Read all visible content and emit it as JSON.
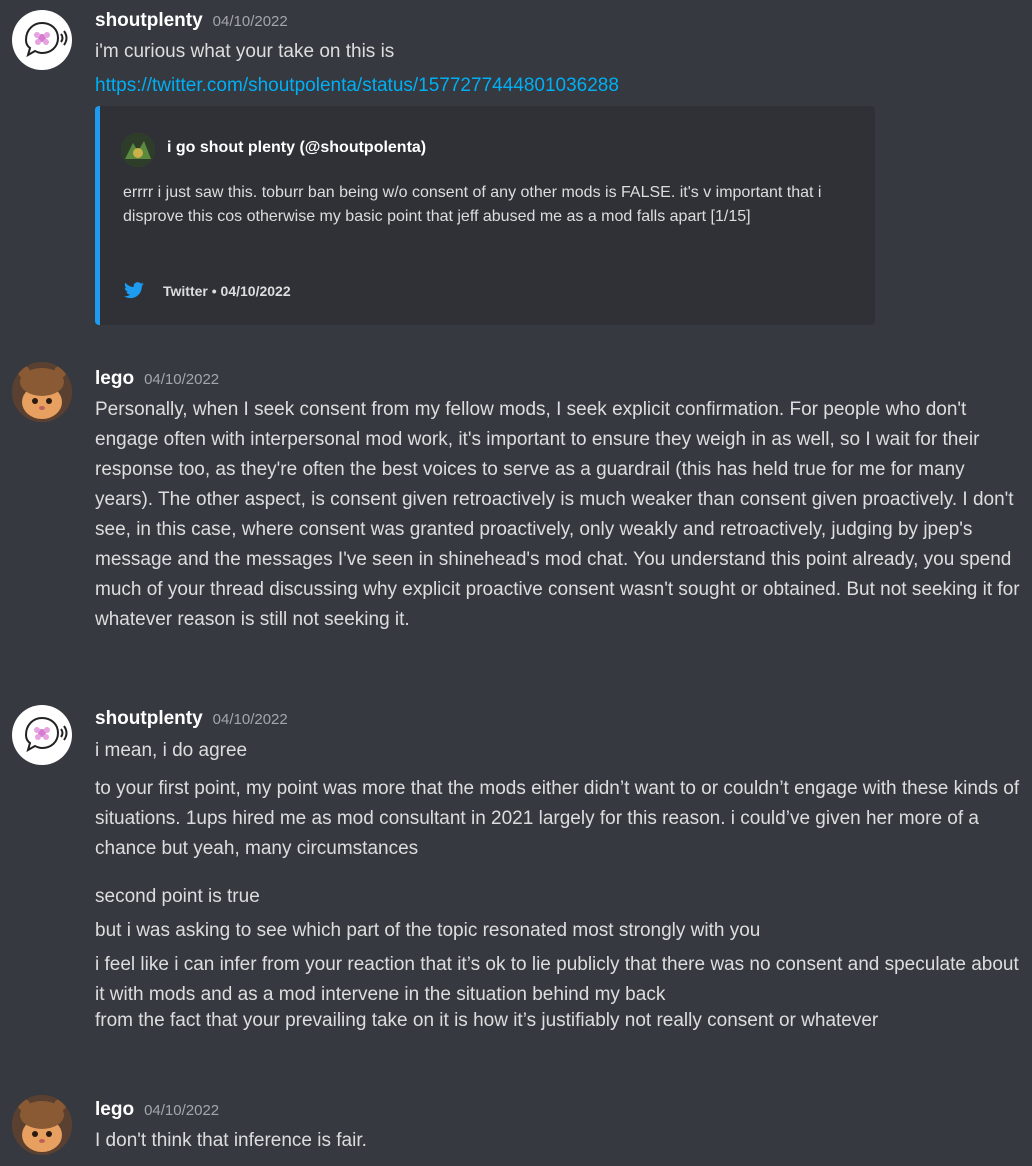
{
  "messages": [
    {
      "author": "shoutplenty",
      "timestamp": "04/10/2022",
      "lines": [
        "i'm curious what your take on this is"
      ],
      "link": "https://twitter.com/shoutpolenta/status/1577277444801036288",
      "embed": {
        "author": "i go shout plenty (@shoutpolenta)",
        "description": "errrr i just saw this. toburr ban being w/o consent of any other mods is FALSE. it's v important that i disprove this cos otherwise my basic point that jeff abused me as a mod falls apart [1/15]",
        "footer": "Twitter • 04/10/2022",
        "accent_color": "#1d9bf0"
      }
    },
    {
      "author": "lego",
      "timestamp": "04/10/2022",
      "text": "Personally, when I seek consent from my fellow mods, I seek explicit confirmation. For people who don't engage often with interpersonal mod work, it's important to ensure they weigh in as well, so I wait for their response too, as they're often the best voices to serve as a guardrail (this has held true for me for many years). The other aspect, is consent given retroactively is much weaker than consent given proactively. I don't see, in this case, where consent was granted proactively, only weakly and retroactively, judging by jpep's message and the messages I've seen in shinehead's mod chat. You understand this point already, you spend much of your thread discussing why explicit proactive consent wasn't sought or obtained. But not seeking it for whatever reason is still not seeking it."
    },
    {
      "author": "shoutplenty",
      "timestamp": "04/10/2022",
      "lines": [
        "i mean, i do agree",
        "to your first point, my point was more that the mods either didn’t want to or couldn’t engage with these kinds of situations. 1ups hired me as mod consultant in 2021 largely for this reason. i could’ve given her more of a chance but yeah, many circumstances",
        "second point is true",
        "but i was asking to see which part of the topic resonated most strongly with you",
        "i feel like i can infer from your reaction that it’s ok to lie publicly that there was no consent and speculate about it with mods and as a mod intervene in the situation behind my back",
        "from the fact that your prevailing take on it is how it’s justifiably not really consent or whatever"
      ]
    },
    {
      "author": "lego",
      "timestamp": "04/10/2022",
      "lines": [
        "I don't think that inference is fair."
      ]
    }
  ]
}
